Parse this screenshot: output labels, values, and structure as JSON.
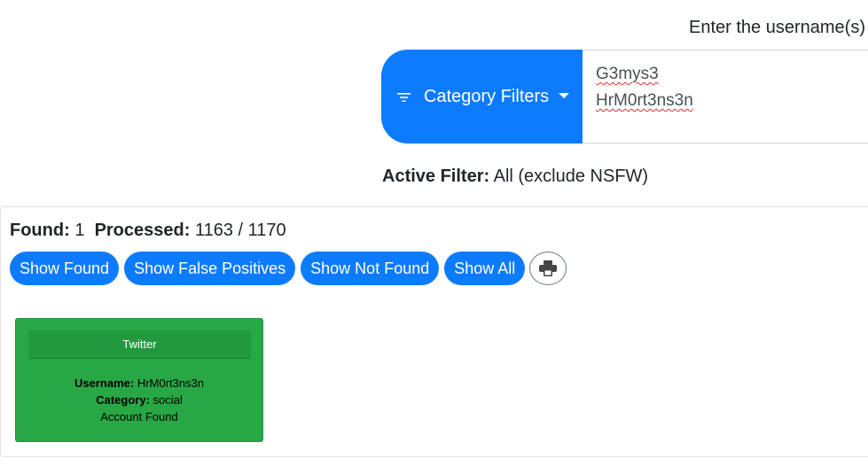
{
  "prompt": "Enter the username(s)",
  "filter_button": {
    "label": "Category Filters",
    "icon": "filter-icon",
    "color": "#0d7bff"
  },
  "username_input": {
    "lines": [
      "G3mys3",
      "HrM0rt3ns3n"
    ]
  },
  "active_filter": {
    "label": "Active Filter:",
    "value": "All (exclude NSFW)"
  },
  "stats": {
    "found_label": "Found:",
    "found_value": "1",
    "processed_label": "Processed:",
    "processed_value": "1163 / 1170"
  },
  "buttons": {
    "show_found": "Show Found",
    "show_false_positives": "Show False Positives",
    "show_not_found": "Show Not Found",
    "show_all": "Show All",
    "print_icon": "print-icon"
  },
  "results": [
    {
      "site": "Twitter",
      "username_label": "Username:",
      "username": "HrM0rt3ns3n",
      "category_label": "Category:",
      "category": "social",
      "status": "Account Found",
      "color": "#28a745"
    }
  ]
}
